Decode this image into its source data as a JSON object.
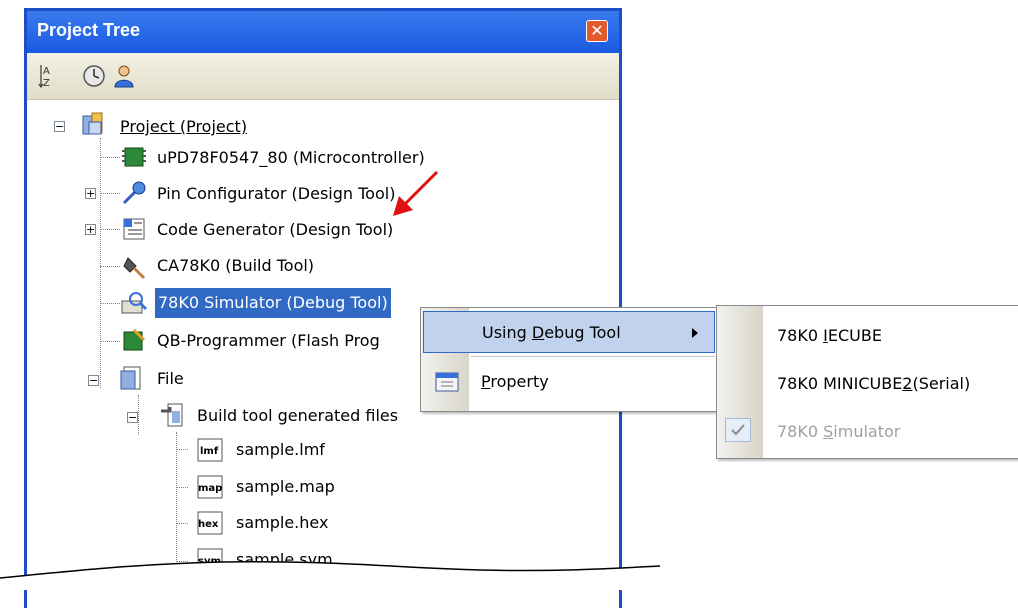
{
  "panel": {
    "title": "Project Tree",
    "close_icon": "close-icon"
  },
  "toolbar": {
    "icons": [
      "sort-az-icon",
      "clock-icon",
      "user-icon"
    ]
  },
  "tree": {
    "root": "Project (Project)",
    "microcontroller": "uPD78F0547_80 (Microcontroller)",
    "pin_configurator": "Pin Configurator (Design Tool)",
    "code_generator": "Code Generator (Design Tool)",
    "build_tool": "CA78K0 (Build Tool)",
    "debug_tool": "78K0 Simulator (Debug Tool)",
    "flash_tool": "QB-Programmer (Flash Prog",
    "file": "File",
    "build_generated": "Build tool generated files",
    "files": [
      "sample.lmf",
      "sample.map",
      "sample.hex",
      "sample.sym"
    ],
    "file_icon_labels": [
      "lmf",
      "map",
      "hex",
      "sym"
    ]
  },
  "context_menu": {
    "using_debug_tool_pre": "Using ",
    "using_debug_tool_key": "D",
    "using_debug_tool_post": "ebug Tool",
    "property_key": "P",
    "property_post": "roperty"
  },
  "submenu": {
    "iecube_pre": "78K0 ",
    "iecube_key": "I",
    "iecube_post": "ECUBE",
    "minicube_pre": "78K0 MINICUBE",
    "minicube_key": "2",
    "minicube_post": "(Serial)",
    "sim_pre": "78K0 ",
    "sim_key": "S",
    "sim_post": "imulator"
  },
  "colors": {
    "title_bar": "#1a5ae0",
    "selection": "#316ac5",
    "arrow": "#e01010",
    "disabled_text": "#a0a0a0"
  }
}
